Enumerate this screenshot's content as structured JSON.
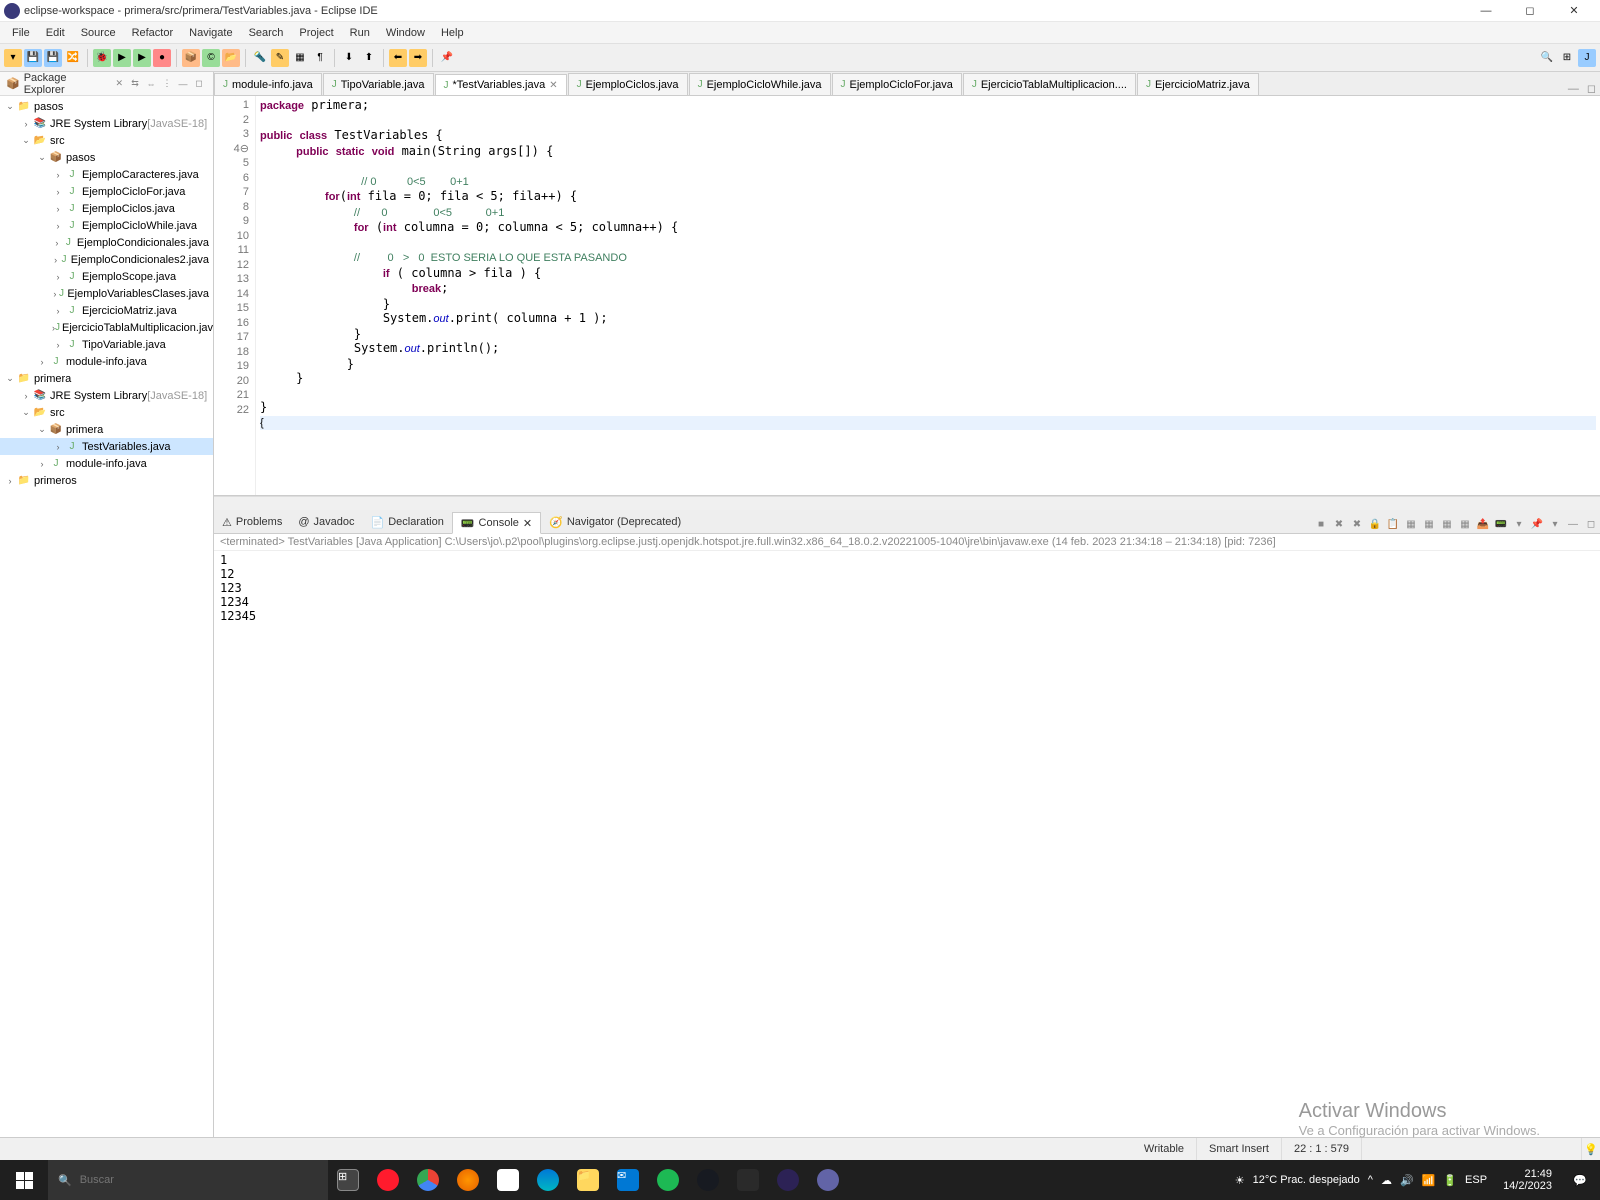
{
  "window": {
    "title": "eclipse-workspace - primera/src/primera/TestVariables.java - Eclipse IDE"
  },
  "menu": [
    "File",
    "Edit",
    "Source",
    "Refactor",
    "Navigate",
    "Search",
    "Project",
    "Run",
    "Window",
    "Help"
  ],
  "explorer": {
    "title": "Package Explorer",
    "tree": [
      {
        "l": 0,
        "exp": "v",
        "ic": "📁",
        "cls": "proj",
        "label": "pasos"
      },
      {
        "l": 1,
        "exp": ">",
        "ic": "📚",
        "cls": "lib",
        "label": "JRE System Library",
        "suffix": " [JavaSE-18]"
      },
      {
        "l": 1,
        "exp": "v",
        "ic": "📂",
        "cls": "fld",
        "label": "src"
      },
      {
        "l": 2,
        "exp": "v",
        "ic": "📦",
        "cls": "pkg",
        "label": "pasos"
      },
      {
        "l": 3,
        "exp": ">",
        "ic": "J",
        "cls": "jfile",
        "label": "EjemploCaracteres.java"
      },
      {
        "l": 3,
        "exp": ">",
        "ic": "J",
        "cls": "jfile",
        "label": "EjemploCicloFor.java"
      },
      {
        "l": 3,
        "exp": ">",
        "ic": "J",
        "cls": "jfile",
        "label": "EjemploCiclos.java"
      },
      {
        "l": 3,
        "exp": ">",
        "ic": "J",
        "cls": "jfile",
        "label": "EjemploCicloWhile.java"
      },
      {
        "l": 3,
        "exp": ">",
        "ic": "J",
        "cls": "jfile",
        "label": "EjemploCondicionales.java"
      },
      {
        "l": 3,
        "exp": ">",
        "ic": "J",
        "cls": "jfile",
        "label": "EjemploCondicionales2.java"
      },
      {
        "l": 3,
        "exp": ">",
        "ic": "J",
        "cls": "jfile",
        "label": "EjemploScope.java"
      },
      {
        "l": 3,
        "exp": ">",
        "ic": "J",
        "cls": "jfile",
        "label": "EjemploVariablesClases.java"
      },
      {
        "l": 3,
        "exp": ">",
        "ic": "J",
        "cls": "jfile",
        "label": "EjercicioMatriz.java"
      },
      {
        "l": 3,
        "exp": ">",
        "ic": "J",
        "cls": "jfile",
        "label": "EjercicioTablaMultiplicacion.java"
      },
      {
        "l": 3,
        "exp": ">",
        "ic": "J",
        "cls": "jfile",
        "label": "TipoVariable.java"
      },
      {
        "l": 2,
        "exp": ">",
        "ic": "J",
        "cls": "jfile",
        "label": "module-info.java"
      },
      {
        "l": 0,
        "exp": "v",
        "ic": "📁",
        "cls": "proj",
        "label": "primera"
      },
      {
        "l": 1,
        "exp": ">",
        "ic": "📚",
        "cls": "lib",
        "label": "JRE System Library",
        "suffix": " [JavaSE-18]"
      },
      {
        "l": 1,
        "exp": "v",
        "ic": "📂",
        "cls": "fld",
        "label": "src"
      },
      {
        "l": 2,
        "exp": "v",
        "ic": "📦",
        "cls": "pkg",
        "label": "primera"
      },
      {
        "l": 3,
        "exp": ">",
        "ic": "J",
        "cls": "jfile",
        "label": "TestVariables.java",
        "sel": true
      },
      {
        "l": 2,
        "exp": ">",
        "ic": "J",
        "cls": "jfile",
        "label": "module-info.java"
      },
      {
        "l": 0,
        "exp": ">",
        "ic": "📁",
        "cls": "proj",
        "label": "primeros"
      }
    ]
  },
  "editorTabs": [
    {
      "label": "module-info.java"
    },
    {
      "label": "TipoVariable.java"
    },
    {
      "label": "*TestVariables.java",
      "active": true,
      "close": true
    },
    {
      "label": "EjemploCiclos.java"
    },
    {
      "label": "EjemploCicloWhile.java"
    },
    {
      "label": "EjemploCicloFor.java"
    },
    {
      "label": "EjercicioTablaMultiplicacion...."
    },
    {
      "label": "EjercicioMatriz.java"
    }
  ],
  "lineCount": 22,
  "bottomTabs": [
    {
      "ic": "⚠",
      "label": "Problems"
    },
    {
      "ic": "@",
      "label": "Javadoc"
    },
    {
      "ic": "📄",
      "label": "Declaration"
    },
    {
      "ic": "📟",
      "label": "Console",
      "active": true,
      "close": true
    },
    {
      "ic": "🧭",
      "label": "Navigator (Deprecated)"
    }
  ],
  "console": {
    "info": "<terminated> TestVariables [Java Application] C:\\Users\\jo\\.p2\\pool\\plugins\\org.eclipse.justj.openjdk.hotspot.jre.full.win32.x86_64_18.0.2.v20221005-1040\\jre\\bin\\javaw.exe  (14 feb. 2023 21:34:18 – 21:34:18) [pid: 7236]",
    "output": "1\n12\n123\n1234\n12345"
  },
  "watermark": {
    "l1": "Activar Windows",
    "l2": "Ve a Configuración para activar Windows."
  },
  "status": {
    "writable": "Writable",
    "insert": "Smart Insert",
    "pos": "22 : 1 : 579"
  },
  "taskbar": {
    "search": "Buscar",
    "weather": "12°C  Prac. despejado",
    "lang": "ESP",
    "time": "21:49",
    "date": "14/2/2023"
  }
}
